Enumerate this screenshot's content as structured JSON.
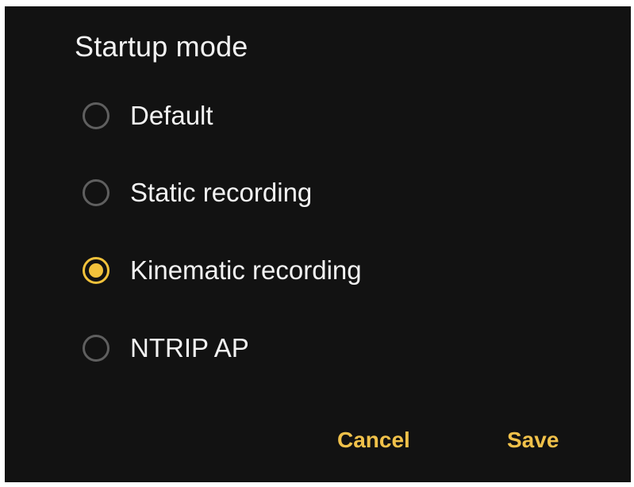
{
  "dialog": {
    "title": "Startup mode",
    "options": [
      {
        "label": "Default",
        "selected": false
      },
      {
        "label": "Static recording",
        "selected": false
      },
      {
        "label": "Kinematic recording",
        "selected": true
      },
      {
        "label": "NTRIP AP",
        "selected": false
      }
    ],
    "cancel_label": "Cancel",
    "save_label": "Save"
  },
  "colors": {
    "background": "#121212",
    "accent": "#f2c23b",
    "text": "#f2f2f2",
    "radio_unchecked": "#5f5f5f"
  }
}
